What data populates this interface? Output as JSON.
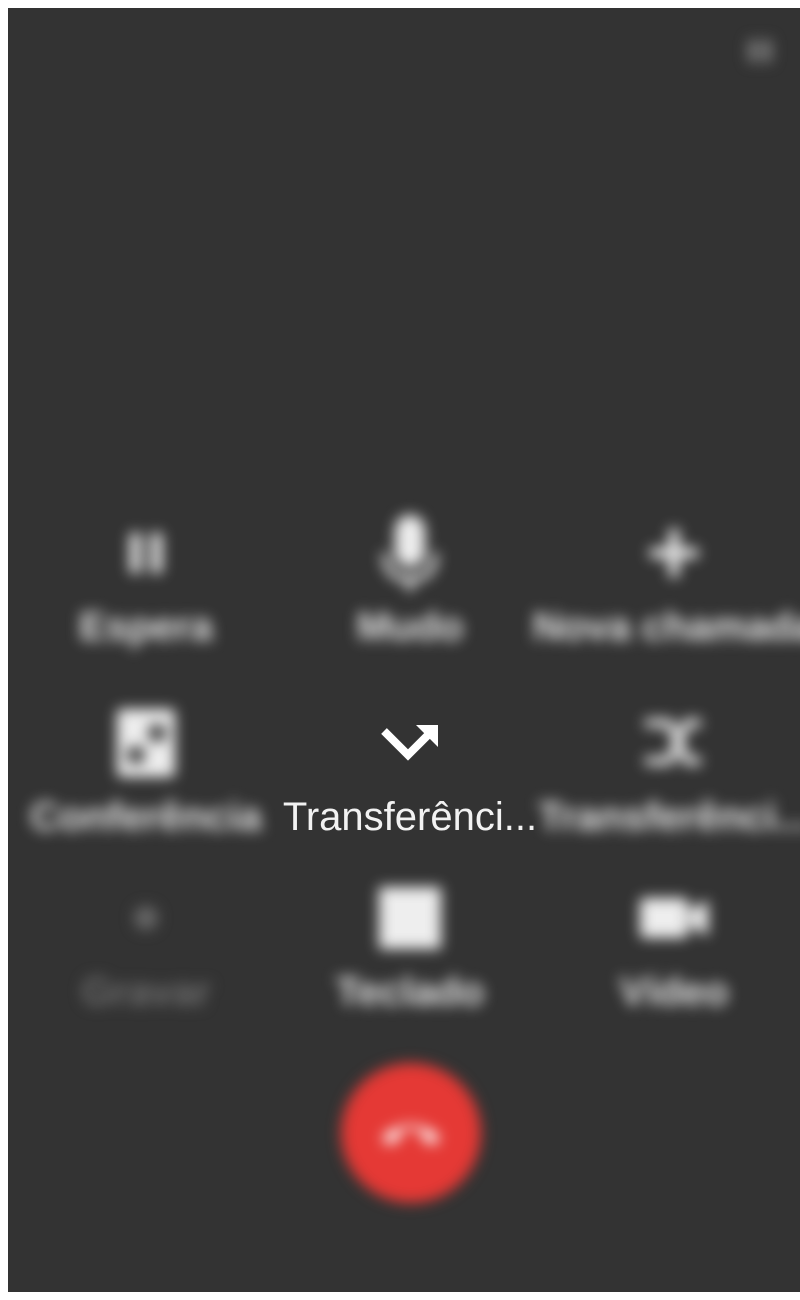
{
  "call": {
    "caller_name": "",
    "caller_number": "",
    "timer": ""
  },
  "controls": [
    {
      "id": "hold",
      "label": "Espera",
      "icon": "pause-icon",
      "state": "blurred"
    },
    {
      "id": "mute",
      "label": "Mudo",
      "icon": "microphone-icon",
      "state": "blurred"
    },
    {
      "id": "new_call",
      "label": "Nova chamada",
      "icon": "plus-icon",
      "state": "blurred"
    },
    {
      "id": "conference",
      "label": "Conferência",
      "icon": "conference-icon",
      "state": "blurred"
    },
    {
      "id": "transfer",
      "label": "Transferênci...",
      "icon": "call-forward-icon",
      "state": "sharp"
    },
    {
      "id": "attended_transfer",
      "label": "Transferênci...",
      "icon": "shuffle-icon",
      "state": "blurred"
    },
    {
      "id": "record",
      "label": "Gravar",
      "icon": "record-icon",
      "state": "disabled"
    },
    {
      "id": "keypad",
      "label": "Teclado",
      "icon": "keypad-icon",
      "state": "blurred"
    },
    {
      "id": "video",
      "label": "Vídeo",
      "icon": "video-icon",
      "state": "blurred"
    }
  ],
  "end_call": {
    "icon": "hang-up-icon",
    "color": "#e53935"
  },
  "colors": {
    "background": "#333333",
    "end_call": "#e53935",
    "label": "#e6e6e6"
  }
}
